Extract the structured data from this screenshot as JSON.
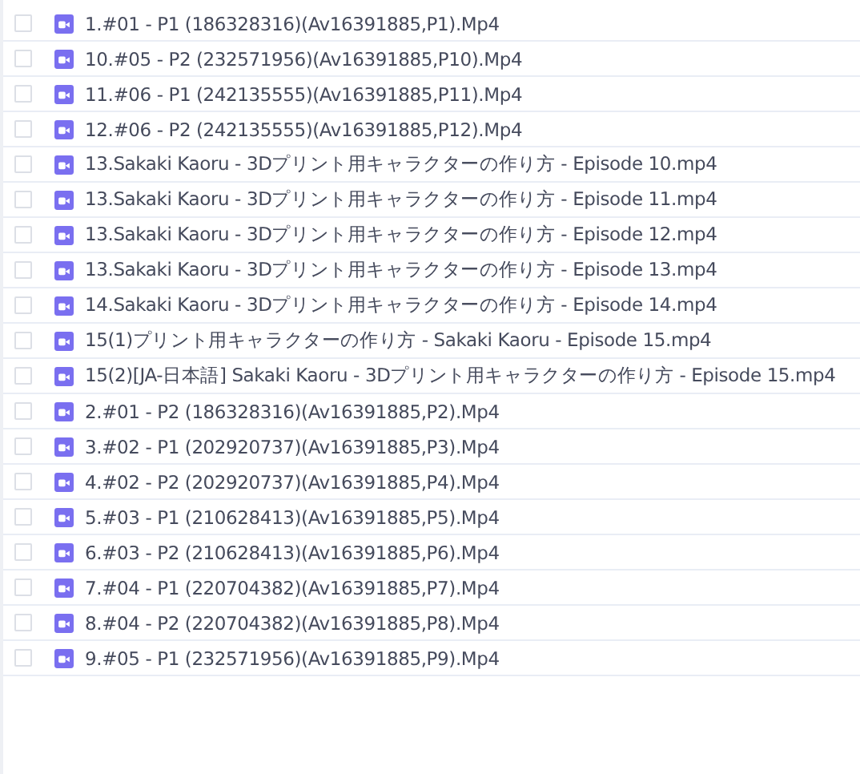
{
  "files": [
    {
      "name": "1.#01 - P1 (186328316)(Av16391885,P1).Mp4",
      "checked": false
    },
    {
      "name": "10.#05 - P2 (232571956)(Av16391885,P10).Mp4",
      "checked": false
    },
    {
      "name": "11.#06 - P1 (242135555)(Av16391885,P11).Mp4",
      "checked": false
    },
    {
      "name": "12.#06 - P2 (242135555)(Av16391885,P12).Mp4",
      "checked": false
    },
    {
      "name": "13.Sakaki Kaoru - 3Dプリント用キャラクターの作り方 - Episode 10.mp4",
      "checked": false
    },
    {
      "name": "13.Sakaki Kaoru - 3Dプリント用キャラクターの作り方 - Episode 11.mp4",
      "checked": false
    },
    {
      "name": "13.Sakaki Kaoru - 3Dプリント用キャラクターの作り方 - Episode 12.mp4",
      "checked": false
    },
    {
      "name": "13.Sakaki Kaoru - 3Dプリント用キャラクターの作り方 - Episode 13.mp4",
      "checked": false
    },
    {
      "name": "14.Sakaki Kaoru - 3Dプリント用キャラクターの作り方 - Episode 14.mp4",
      "checked": false
    },
    {
      "name": "15(1)プリント用キャラクターの作り方 - Sakaki Kaoru - Episode 15.mp4",
      "checked": false
    },
    {
      "name": "15(2)[JA-日本語] Sakaki Kaoru - 3Dプリント用キャラクターの作り方 - Episode 15.mp4",
      "checked": false
    },
    {
      "name": "2.#01 - P2 (186328316)(Av16391885,P2).Mp4",
      "checked": false
    },
    {
      "name": "3.#02 - P1 (202920737)(Av16391885,P3).Mp4",
      "checked": false
    },
    {
      "name": "4.#02 - P2 (202920737)(Av16391885,P4).Mp4",
      "checked": false
    },
    {
      "name": "5.#03 - P1 (210628413)(Av16391885,P5).Mp4",
      "checked": false
    },
    {
      "name": "6.#03 - P2 (210628413)(Av16391885,P6).Mp4",
      "checked": false
    },
    {
      "name": "7.#04 - P1 (220704382)(Av16391885,P7).Mp4",
      "checked": false
    },
    {
      "name": "8.#04 - P2 (220704382)(Av16391885,P8).Mp4",
      "checked": false
    },
    {
      "name": "9.#05 - P1 (232571956)(Av16391885,P9).Mp4",
      "checked": false
    }
  ]
}
